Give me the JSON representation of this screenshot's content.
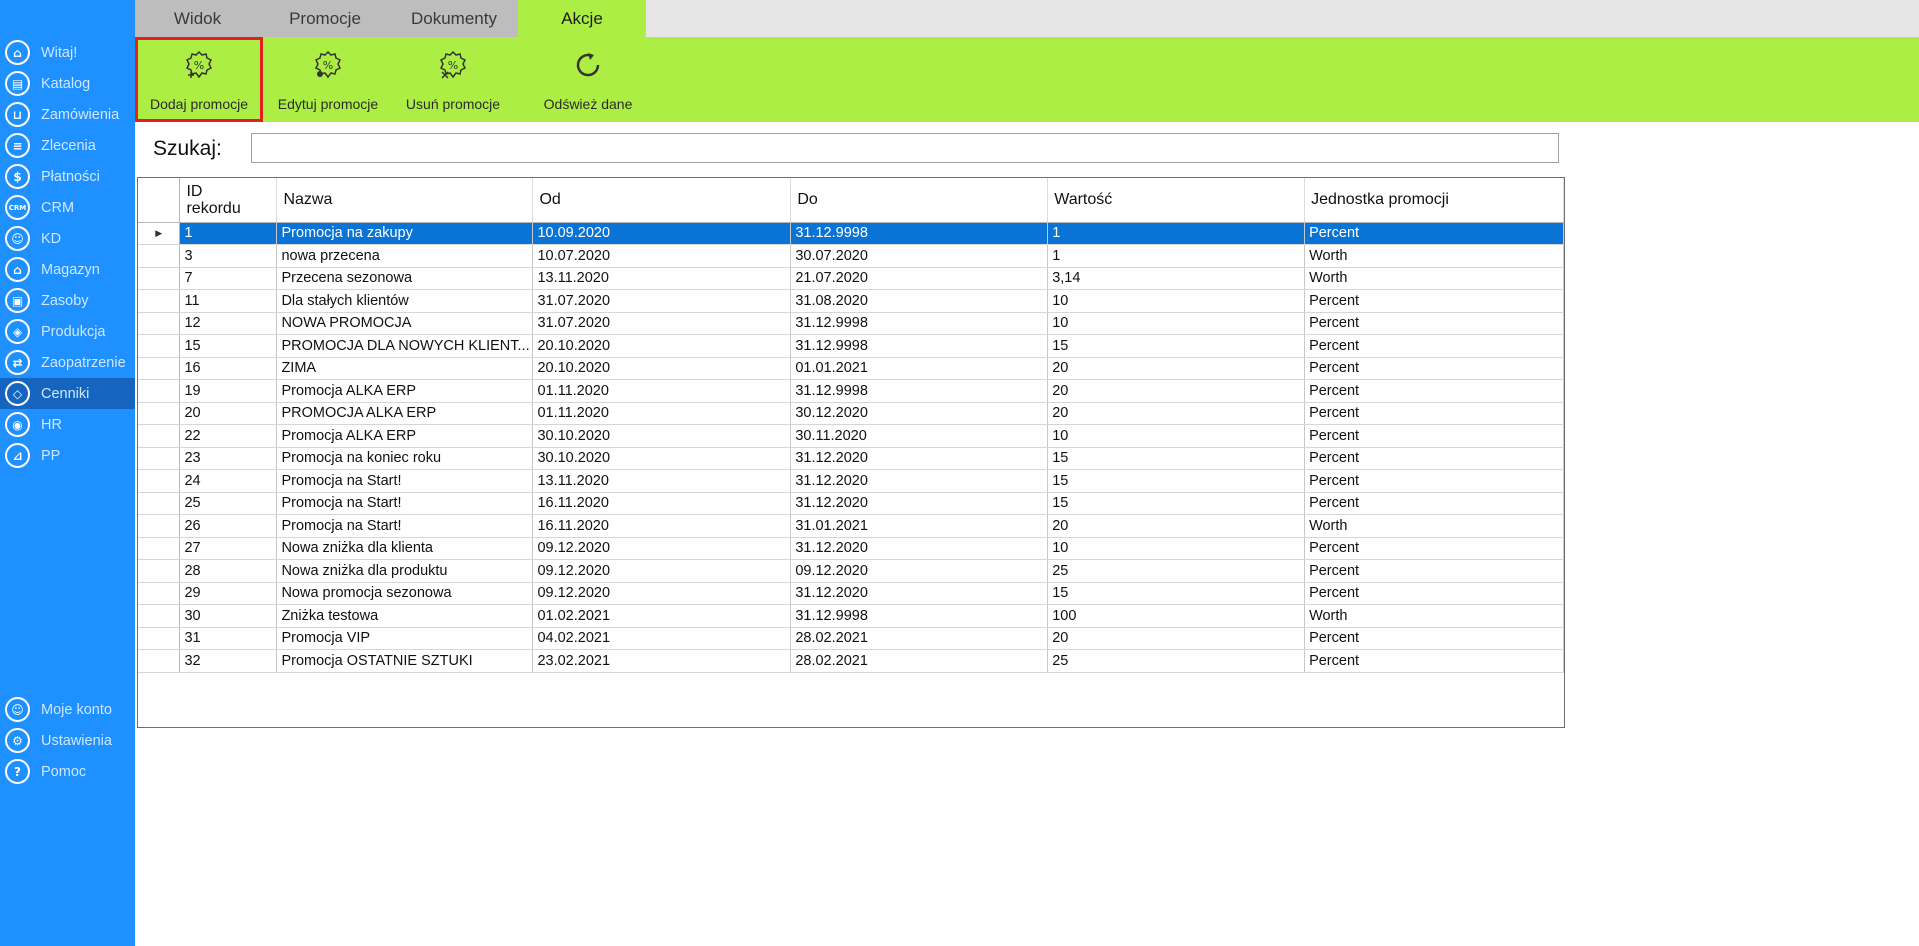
{
  "tabs": [
    "Widok",
    "Promocje",
    "Dokumenty",
    "Akcje"
  ],
  "active_tab": "Akcje",
  "ribbon": {
    "add": "Dodaj promocje",
    "edit": "Edytuj promocje",
    "delete": "Usuń promocje",
    "refresh": "Odśwież dane"
  },
  "sidebar": {
    "items": [
      {
        "label": "Witaj!",
        "icon": "home-icon"
      },
      {
        "label": "Katalog",
        "icon": "book-icon"
      },
      {
        "label": "Zamówienia",
        "icon": "cart-icon"
      },
      {
        "label": "Zlecenia",
        "icon": "list-icon"
      },
      {
        "label": "Płatności",
        "icon": "dollar-icon"
      },
      {
        "label": "CRM",
        "icon": "crm-icon"
      },
      {
        "label": "KD",
        "icon": "person-icon"
      },
      {
        "label": "Magazyn",
        "icon": "warehouse-icon"
      },
      {
        "label": "Zasoby",
        "icon": "resources-icon"
      },
      {
        "label": "Produkcja",
        "icon": "production-icon"
      },
      {
        "label": "Zaopatrzenie",
        "icon": "truck-icon"
      },
      {
        "label": "Cenniki",
        "icon": "tag-icon"
      },
      {
        "label": "HR",
        "icon": "hr-icon"
      },
      {
        "label": "PP",
        "icon": "pp-icon"
      }
    ],
    "bottom_items": [
      {
        "label": "Moje konto",
        "icon": "account-icon"
      },
      {
        "label": "Ustawienia",
        "icon": "settings-icon"
      },
      {
        "label": "Pomoc",
        "icon": "help-icon"
      }
    ],
    "active": "Cenniki"
  },
  "search": {
    "label": "Szukaj:",
    "value": ""
  },
  "table": {
    "headers": [
      "ID rekordu",
      "Nazwa",
      "Od",
      "Do",
      "Wartość",
      "Jednostka promocji"
    ],
    "rows": [
      [
        "1",
        "Promocja na zakupy",
        "10.09.2020",
        "31.12.9998",
        "1",
        "Percent"
      ],
      [
        "3",
        "nowa przecena",
        "10.07.2020",
        "30.07.2020",
        "1",
        "Worth"
      ],
      [
        "7",
        "Przecena sezonowa",
        "13.11.2020",
        "21.07.2020",
        "3,14",
        "Worth"
      ],
      [
        "11",
        "Dla stałych klientów",
        "31.07.2020",
        "31.08.2020",
        "10",
        "Percent"
      ],
      [
        "12",
        "NOWA PROMOCJA",
        "31.07.2020",
        "31.12.9998",
        "10",
        "Percent"
      ],
      [
        "15",
        "PROMOCJA DLA NOWYCH KLIENT...",
        "20.10.2020",
        "31.12.9998",
        "15",
        "Percent"
      ],
      [
        "16",
        "ZIMA",
        "20.10.2020",
        "01.01.2021",
        "20",
        "Percent"
      ],
      [
        "19",
        "Promocja ALKA ERP",
        "01.11.2020",
        "31.12.9998",
        "20",
        "Percent"
      ],
      [
        "20",
        "PROMOCJA ALKA ERP",
        "01.11.2020",
        "30.12.2020",
        "20",
        "Percent"
      ],
      [
        "22",
        "Promocja ALKA ERP",
        "30.10.2020",
        "30.11.2020",
        "10",
        "Percent"
      ],
      [
        "23",
        "Promocja na koniec roku",
        "30.10.2020",
        "31.12.2020",
        "15",
        "Percent"
      ],
      [
        "24",
        "Promocja na Start!",
        "13.11.2020",
        "31.12.2020",
        "15",
        "Percent"
      ],
      [
        "25",
        "Promocja na Start!",
        "16.11.2020",
        "31.12.2020",
        "15",
        "Percent"
      ],
      [
        "26",
        "Promocja na Start!",
        "16.11.2020",
        "31.01.2021",
        "20",
        "Worth"
      ],
      [
        "27",
        "Nowa zniżka dla klienta",
        "09.12.2020",
        "31.12.2020",
        "10",
        "Percent"
      ],
      [
        "28",
        "Nowa zniżka dla produktu",
        "09.12.2020",
        "09.12.2020",
        "25",
        "Percent"
      ],
      [
        "29",
        "Nowa promocja sezonowa",
        "09.12.2020",
        "31.12.2020",
        "15",
        "Percent"
      ],
      [
        "30",
        "Zniżka testowa",
        "01.02.2021",
        "31.12.9998",
        "100",
        "Worth"
      ],
      [
        "31",
        "Promocja VIP",
        "04.02.2021",
        "28.02.2021",
        "20",
        "Percent"
      ],
      [
        "32",
        "Promocja OSTATNIE SZTUKI",
        "23.02.2021",
        "28.02.2021",
        "25",
        "Percent"
      ]
    ],
    "selected_row": 0
  },
  "colors": {
    "sidebar": "#1e90ff",
    "sidebar_active": "#1565c0",
    "ribbon": "#adee45",
    "selection": "#0a74d6",
    "highlight_border": "#e02020"
  }
}
